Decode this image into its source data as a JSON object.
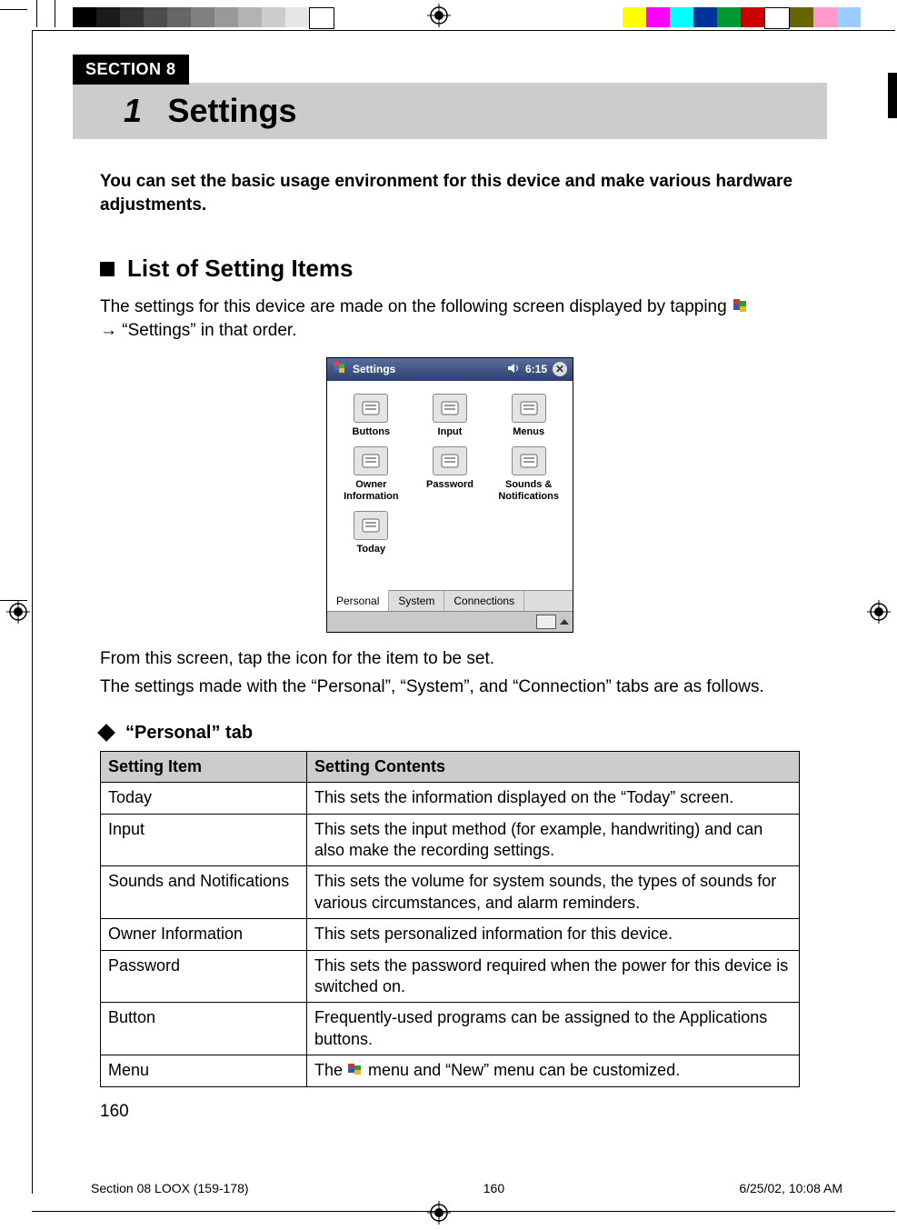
{
  "colorbar": {
    "left": [
      "#000000",
      "#1a1a1a",
      "#333333",
      "#4d4d4d",
      "#666666",
      "#808080",
      "#999999",
      "#b3b3b3",
      "#cccccc",
      "#e6e6e6",
      "#ffffff"
    ],
    "right": [
      "#ffff00",
      "#ff00ff",
      "#00ffff",
      "#003399",
      "#009933",
      "#cc0000",
      "#ffffff",
      "#666600",
      "#ff99cc",
      "#99ccff"
    ]
  },
  "section_tab": "SECTION 8",
  "chapter": {
    "num": "1",
    "title": "Settings"
  },
  "intro": "You can set the basic usage environment for this device and make various hardware adjustments.",
  "heading_list": "List of Setting Items",
  "list_intro_1": "The settings for this device are made on the following screen displayed by tapping ",
  "list_intro_2": "→ “Settings” in that order.",
  "pda": {
    "title": "Settings",
    "volume_icon": "volume-icon",
    "time": "6:15",
    "items": [
      "Buttons",
      "Input",
      "Menus",
      "Owner Information",
      "Password",
      "Sounds & Notifications",
      "Today"
    ],
    "tabs": [
      "Personal",
      "System",
      "Connections"
    ],
    "active_tab": 0
  },
  "after_shot_1": "From this screen, tap the icon for the item to be set.",
  "after_shot_2": "The settings made with the “Personal”, “System”, and “Connection” tabs are as follows.",
  "h3_personal": "“Personal” tab",
  "table": {
    "header": {
      "item": "Setting Item",
      "contents": "Setting Contents"
    },
    "rows": [
      {
        "item": "Today",
        "contents": "This sets the information displayed on the “Today” screen."
      },
      {
        "item": "Input",
        "contents": "This sets the input method (for example, handwriting) and can also make the recording settings."
      },
      {
        "item": "Sounds and Notifications",
        "contents": "This sets the volume for system sounds, the types of sounds for various circumstances, and alarm reminders."
      },
      {
        "item": "Owner Information",
        "contents": "This sets personalized information for this device."
      },
      {
        "item": "Password",
        "contents": "This sets the password required when the power for this device is switched on."
      },
      {
        "item": "Button",
        "contents": "Frequently-used programs can be assigned to the Applications buttons."
      },
      {
        "item": "Menu",
        "contents_pre": "The ",
        "contents_post": " menu and “New” menu can be customized.",
        "has_icon": true
      }
    ]
  },
  "page_number": "160",
  "footer": {
    "file": "Section 08 LOOX (159-178)",
    "page": "160",
    "datetime": "6/25/02, 10:08 AM"
  }
}
